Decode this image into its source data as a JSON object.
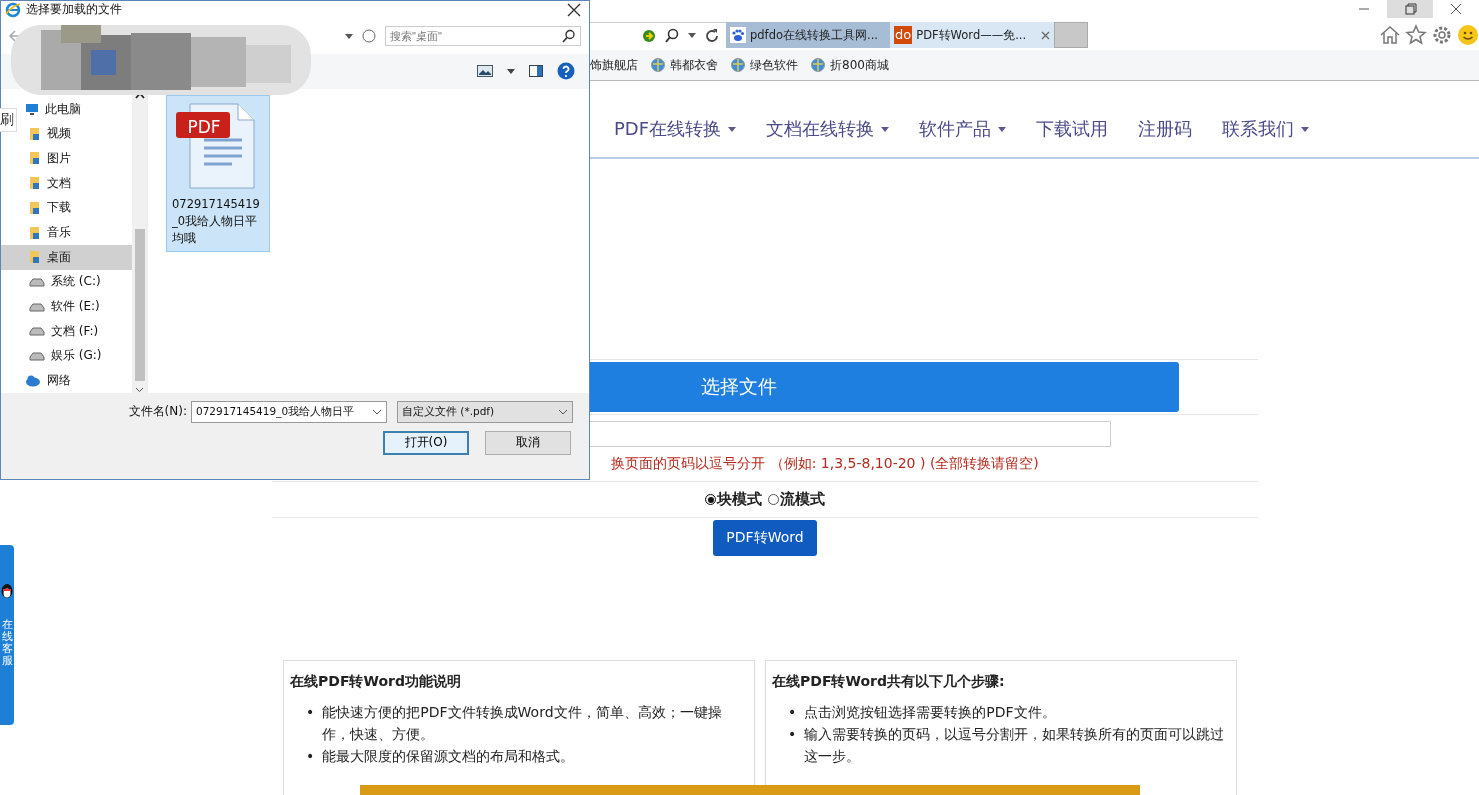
{
  "browser": {
    "tabs": [
      {
        "label": "pdfdo在线转换工具网...",
        "selected": false
      },
      {
        "label": "PDF转Word——免...",
        "selected": true,
        "kind": "lettered",
        "favicon_text": "do"
      }
    ],
    "favorites": [
      {
        "label": "饰旗舰店",
        "icon": false
      },
      {
        "label": "韩都衣舍",
        "icon": true
      },
      {
        "label": "绿色软件",
        "icon": true
      },
      {
        "label": "折800商城",
        "icon": true
      }
    ]
  },
  "nav": [
    {
      "label": "PDF在线转换",
      "dropdown": true
    },
    {
      "label": "文档在线转换",
      "dropdown": true
    },
    {
      "label": "软件产品",
      "dropdown": true
    },
    {
      "label": "下载试用",
      "dropdown": false
    },
    {
      "label": "注册码",
      "dropdown": false
    },
    {
      "label": "联系我们",
      "dropdown": true
    }
  ],
  "converter": {
    "select_button": "选择文件",
    "hint": "换页面的页码以逗号分开 （例如: 1,3,5-8,10-20 ) (全部转换请留空)",
    "modes": [
      {
        "label": "块模式",
        "selected": true
      },
      {
        "label": "流模式",
        "selected": false
      }
    ],
    "convert_button": "PDF转Word"
  },
  "panels": [
    {
      "title": "在线PDF转Word功能说明",
      "bullet": "•",
      "items": [
        "能快速方便的把PDF文件转换成Word文件，简单、高效；一键操作，快速、方便。",
        "能最大限度的保留源文档的布局和格式。"
      ]
    },
    {
      "title": "在线PDF转Word共有以下几个步骤:",
      "bullet": "•",
      "items": [
        "点击浏览按钮选择需要转换的PDF文件。",
        "输入需要转换的页码，以逗号分割开，如果转换所有的页面可以跳过这一步。"
      ]
    }
  ],
  "chat_tab": {
    "label": "在线客服"
  },
  "tooltip_fragment": "刷",
  "dialog": {
    "title": "选择要加载的文件",
    "search_placeholder": "搜索\"桌面\"",
    "tree": [
      {
        "label": "此电脑",
        "kind": "pc",
        "selected": false,
        "children": [
          {
            "label": "视频",
            "kind": "folder",
            "selected": false
          },
          {
            "label": "图片",
            "kind": "folder",
            "selected": false
          },
          {
            "label": "文档",
            "kind": "folder",
            "selected": false
          },
          {
            "label": "下载",
            "kind": "folder",
            "selected": false
          },
          {
            "label": "音乐",
            "kind": "folder",
            "selected": false
          },
          {
            "label": "桌面",
            "kind": "folder",
            "selected": true
          },
          {
            "label": "系统 (C:)",
            "kind": "drive",
            "selected": false
          },
          {
            "label": "软件 (E:)",
            "kind": "drive",
            "selected": false
          },
          {
            "label": "文档 (F:)",
            "kind": "drive",
            "selected": false
          },
          {
            "label": "娱乐 (G:)",
            "kind": "drive",
            "selected": false
          }
        ]
      },
      {
        "label": "网络",
        "kind": "network",
        "selected": false
      }
    ],
    "files": [
      {
        "name": "072917145419_0我给人物日平均哦",
        "badge": "PDF",
        "selected": true
      }
    ],
    "filename_label": "文件名(N):",
    "filename_value": "072917145419_0我给人物日平",
    "filetype": "自定义文件 (*.pdf)",
    "buttons": [
      {
        "label": "打开(O)",
        "default": true
      },
      {
        "label": "取消",
        "default": false
      }
    ]
  }
}
